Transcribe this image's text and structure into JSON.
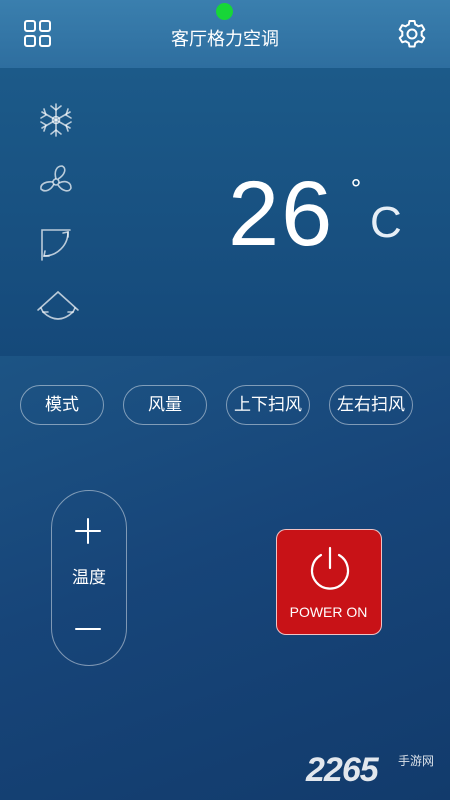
{
  "header": {
    "title": "客厅格力空调",
    "menu_icon": "grid-menu-icon",
    "settings_icon": "gear-icon",
    "status_color": "#17d638"
  },
  "display": {
    "mode_icons": [
      "snowflake-icon",
      "fan-icon",
      "swing-vertical-icon",
      "swing-horizontal-icon"
    ],
    "temperature": "26",
    "degree_symbol": "°",
    "unit": "C"
  },
  "functions": [
    {
      "label": "模式"
    },
    {
      "label": "风量"
    },
    {
      "label": "上下扫风"
    },
    {
      "label": "左右扫风"
    }
  ],
  "temp_control": {
    "label": "温度",
    "plus_icon": "plus-icon",
    "minus_icon": "minus-icon"
  },
  "power": {
    "label": "POWER ON",
    "icon": "power-icon",
    "color": "#c81217"
  },
  "watermark": {
    "number": "2265",
    "text": "手游网"
  }
}
